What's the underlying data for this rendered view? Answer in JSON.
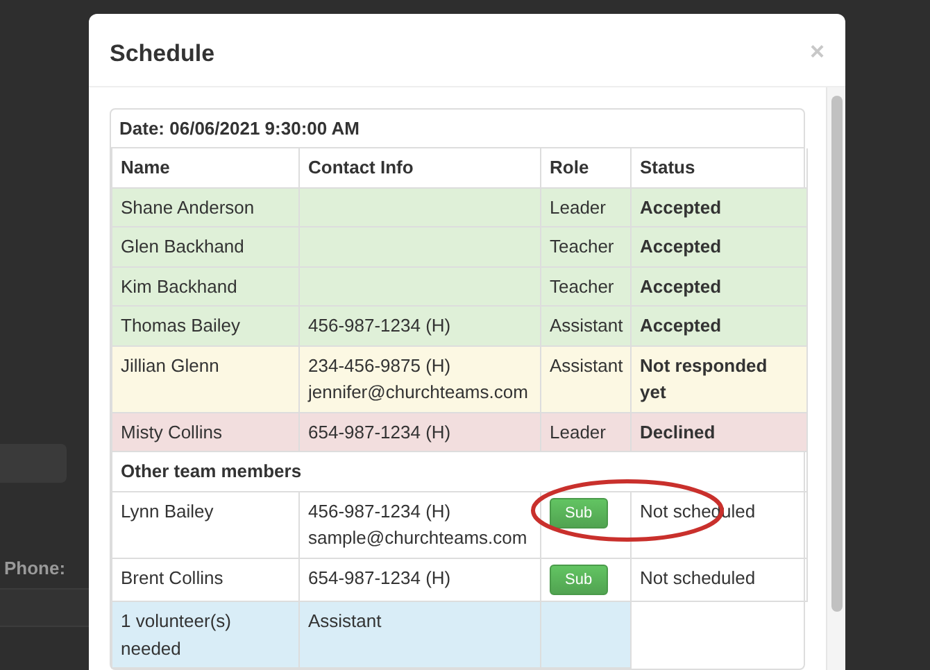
{
  "background": {
    "field_label": "Phone:"
  },
  "modal": {
    "title": "Schedule",
    "close": "×",
    "date": "Date: 06/06/2021 9:30:00 AM",
    "columns": [
      "Name",
      "Contact Info",
      "Role",
      "Status"
    ],
    "scheduled": [
      {
        "name": "Shane Anderson",
        "role": "Leader",
        "status": "Accepted",
        "color": "#dff0d8"
      },
      {
        "name": "Glen Backhand",
        "role": "Teacher",
        "status": "Accepted",
        "color": "#dff0d8"
      },
      {
        "name": "Kim Backhand",
        "role": "Teacher",
        "status": "Accepted",
        "color": "#dff0d8"
      },
      {
        "name": "Thomas Bailey",
        "contact": [
          "456-987-1234 (H)"
        ],
        "role": "Assistant",
        "status": "Accepted",
        "color": "#dff0d8"
      },
      {
        "name": "Jillian Glenn",
        "contact": [
          "234-456-9875 (H)",
          "jennifer@churchteams.com"
        ],
        "role": "Assistant",
        "status": "Not responded yet",
        "color": "#fcf8e3"
      },
      {
        "name": "Misty Collins",
        "contact": [
          "654-987-1234 (H)"
        ],
        "role": "Leader",
        "status": "Declined",
        "color": "#f2dede"
      }
    ],
    "other_heading": "Other team members",
    "others": [
      {
        "kind": "member",
        "name": "Lynn Bailey",
        "contact": [
          "456-987-1234 (H)",
          "sample@churchteams.com"
        ],
        "button": "Sub",
        "status": "Not scheduled",
        "highlighted": true
      },
      {
        "kind": "member",
        "name": "Brent Collins",
        "contact": [
          "654-987-1234 (H)"
        ],
        "button": "Sub",
        "status": "Not scheduled",
        "highlighted": false
      },
      {
        "kind": "need",
        "name": "1 volunteer(s) needed",
        "role": "Assistant"
      }
    ]
  }
}
